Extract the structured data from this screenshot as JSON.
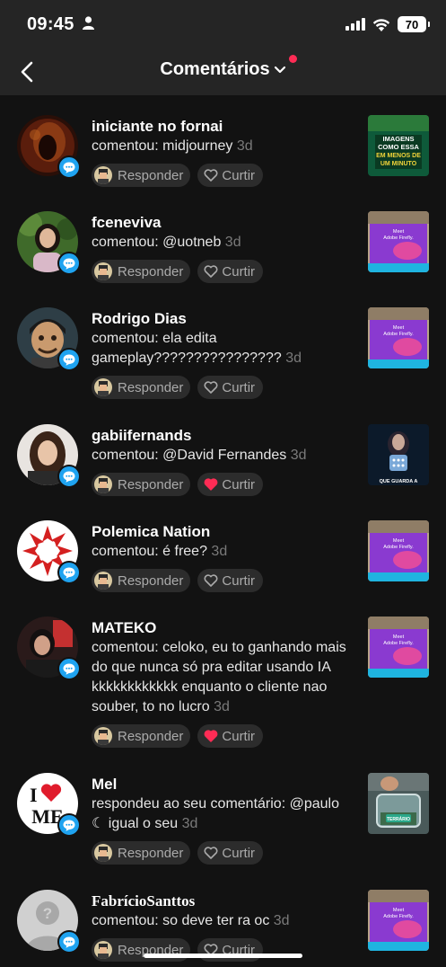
{
  "status": {
    "time": "09:45",
    "battery": "70"
  },
  "header": {
    "title": "Comentários"
  },
  "actions": {
    "reply": "Responder",
    "like": "Curtir"
  },
  "notifications": [
    {
      "user": "iniciante no fornai",
      "text": "comentou: midjourney",
      "time": "3d",
      "liked": false,
      "thumb": "imagens",
      "thumb_text": [
        "IMAGENS",
        "COMO ESSA",
        "EM MENOS DE",
        "UM MINUTO"
      ]
    },
    {
      "user": "fceneviva",
      "text": "comentou: @uotneb",
      "time": "3d",
      "liked": false,
      "thumb": "firefly",
      "thumb_text": [
        "Meet",
        "Adobe Firefly."
      ]
    },
    {
      "user": "Rodrigo Dias",
      "text": "comentou: ela edita gameplay????????????????",
      "time": "3d",
      "liked": false,
      "thumb": "firefly",
      "thumb_text": [
        "Meet",
        "Adobe Firefly."
      ]
    },
    {
      "user": "gabiifernands",
      "text": "comentou: @David Fernandes",
      "time": "3d",
      "liked": true,
      "thumb": "portrait",
      "thumb_text": [
        "QUE GUARDA A"
      ]
    },
    {
      "user": "Polemica Nation",
      "text": "comentou: é free?",
      "time": "3d",
      "liked": false,
      "thumb": "firefly",
      "thumb_text": [
        "Meet",
        "Adobe Firefly."
      ]
    },
    {
      "user": "MATEKO",
      "text": "comentou: celoko, eu to ganhando mais do que nunca só pra editar usando IA kkkkkkkkkkkk enquanto o cliente nao souber, to no lucro",
      "time": "3d",
      "liked": true,
      "thumb": "firefly",
      "thumb_text": [
        "Meet",
        "Adobe Firefly."
      ]
    },
    {
      "user": "Mel",
      "text": "respondeu ao seu comentário: @paulo ☾ igual o seu",
      "time": "3d",
      "liked": false,
      "thumb": "terrario",
      "thumb_text": [
        "TERRÁRIO"
      ]
    },
    {
      "user": "FabrícioSanttos",
      "text": "comentou: so deve ter ra oc",
      "time": "3d",
      "liked": false,
      "thumb": "firefly",
      "thumb_text": [
        "Meet",
        "Adobe Firefly."
      ]
    }
  ],
  "avatar_texts": {
    "mel_logo": [
      "I",
      "ME"
    ]
  },
  "colors": {
    "accent_blue": "#1fa3f0",
    "like_red": "#fe2c55",
    "background": "#121212",
    "header": "#252525"
  }
}
